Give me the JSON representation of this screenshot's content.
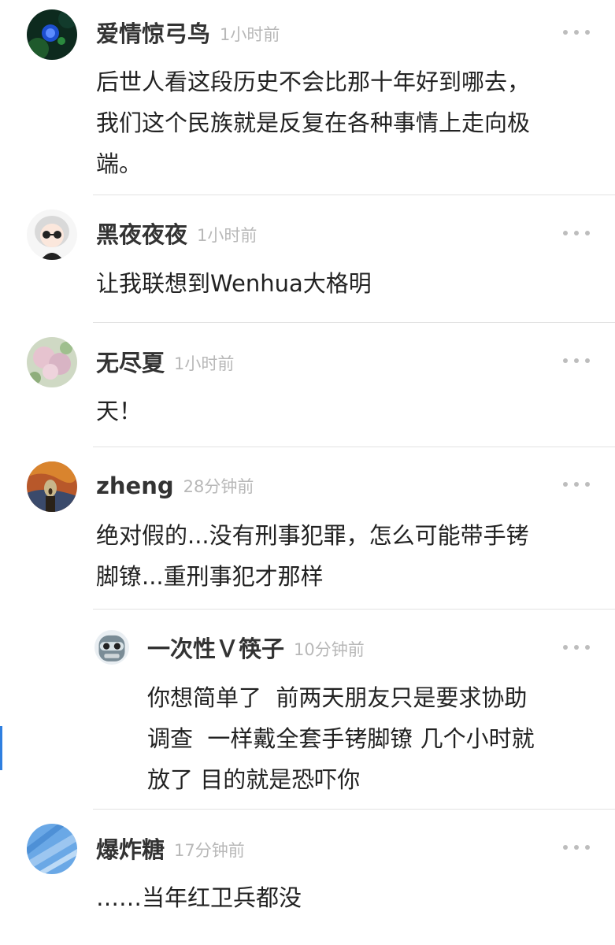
{
  "comments": [
    {
      "user": "爱情惊弓鸟",
      "time": "1小时前",
      "text": "后世人看这段历史不会比那十年好到哪去，\n我们这个民族就是反复在各种事情上走向极\n端。",
      "avatar_icon": "blue-flower-avatar"
    },
    {
      "user": "黑夜夜夜",
      "time": "1小时前",
      "text": "让我联想到Wenhua大格明",
      "avatar_icon": "sunglasses-girl-avatar"
    },
    {
      "user": "无尽夏",
      "time": "1小时前",
      "text": "天！",
      "avatar_icon": "hydrangea-avatar"
    },
    {
      "user": "zheng",
      "time": "28分钟前",
      "text": "绝对假的...没有刑事犯罪，怎么可能带手铐\n脚镣...重刑事犯才那样",
      "avatar_icon": "scream-painting-avatar"
    },
    {
      "user": "一次性Ｖ筷子",
      "time": "10分钟前",
      "text": "你想简单了  前两天朋友只是要求协助\n调查  一样戴全套手铐脚镣 几个小时就\n放了 目的就是恐吓你",
      "avatar_icon": "robot-avatar",
      "is_reply": true
    },
    {
      "user": "爆炸糖",
      "time": "17分钟前",
      "text": "……当年红卫兵都没",
      "avatar_icon": "blue-sky-avatar"
    }
  ],
  "more_icon": "more-dots-icon",
  "colors": {
    "username": "#333333",
    "time": "#b8b8b8",
    "body_text": "#222222",
    "divider": "#e2e2e2",
    "more_dots": "#bdbdbd"
  }
}
